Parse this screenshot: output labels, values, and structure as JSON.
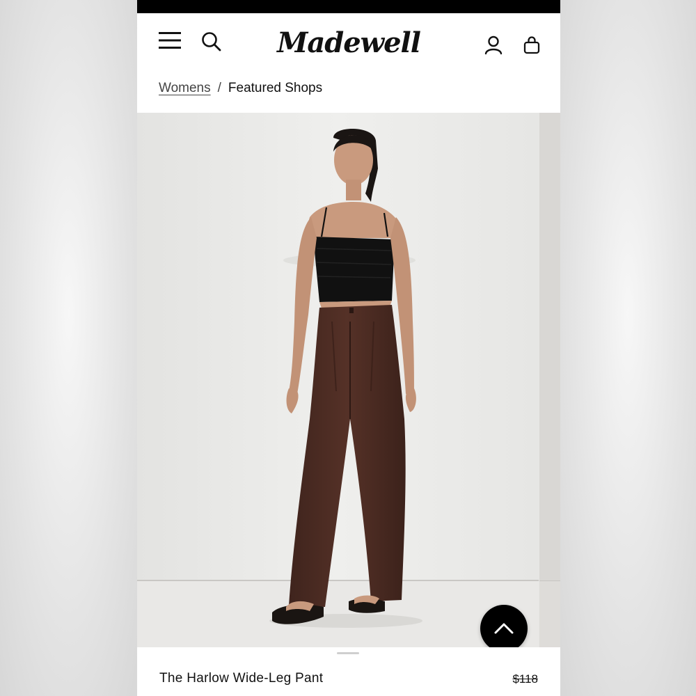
{
  "header": {
    "brand": "Madewell",
    "icons": {
      "menu": "menu-icon",
      "search": "search-icon",
      "account": "account-icon",
      "bag": "bag-icon"
    }
  },
  "breadcrumb": {
    "items": [
      {
        "label": "Womens",
        "link": true
      },
      {
        "label": "Featured Shops",
        "link": false
      }
    ],
    "separator": "/"
  },
  "product": {
    "name": "The Harlow Wide-Leg Pant",
    "price": "$118",
    "image_description_colors": {
      "pants": "#4a2a22",
      "top": "#111111",
      "wall": "#ececea"
    }
  },
  "controls": {
    "scroll_top_icon": "chevron-up-icon"
  }
}
